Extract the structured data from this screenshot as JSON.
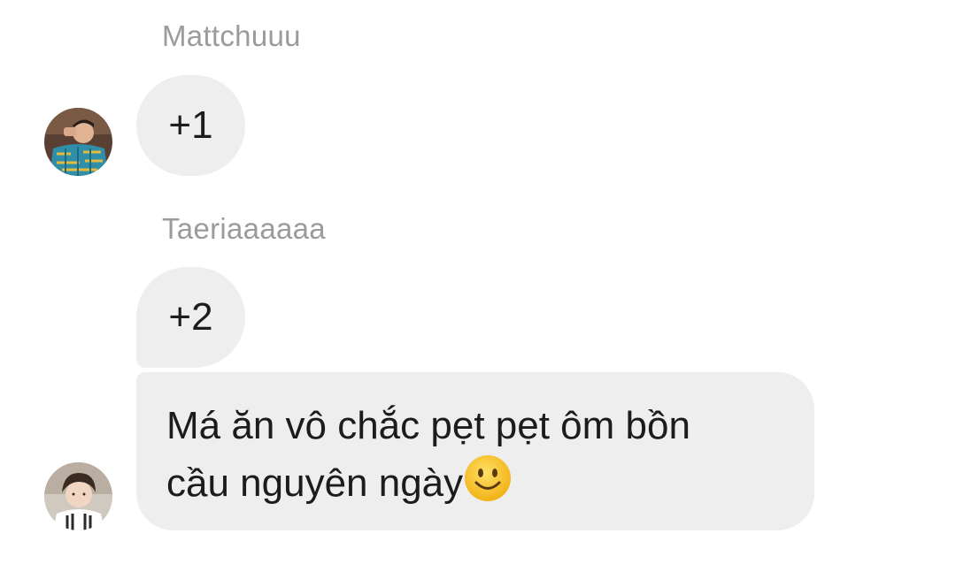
{
  "messages": [
    {
      "sender": "Mattchuuu",
      "text": "+1"
    },
    {
      "sender": "Taeriaaaaaa",
      "text": "+2"
    },
    {
      "text_line1": "Má ăn vô chắc pẹt pẹt ôm bồn",
      "text_line2": "cầu nguyên ngày"
    }
  ],
  "colors": {
    "bubble": "#eeeeee",
    "sender_name": "#9b9b9b",
    "message_text": "#1c1c1c",
    "emoji": "#f6c12b"
  },
  "icons": {
    "emoji": "slightly-smiling-face-emoji-icon"
  }
}
